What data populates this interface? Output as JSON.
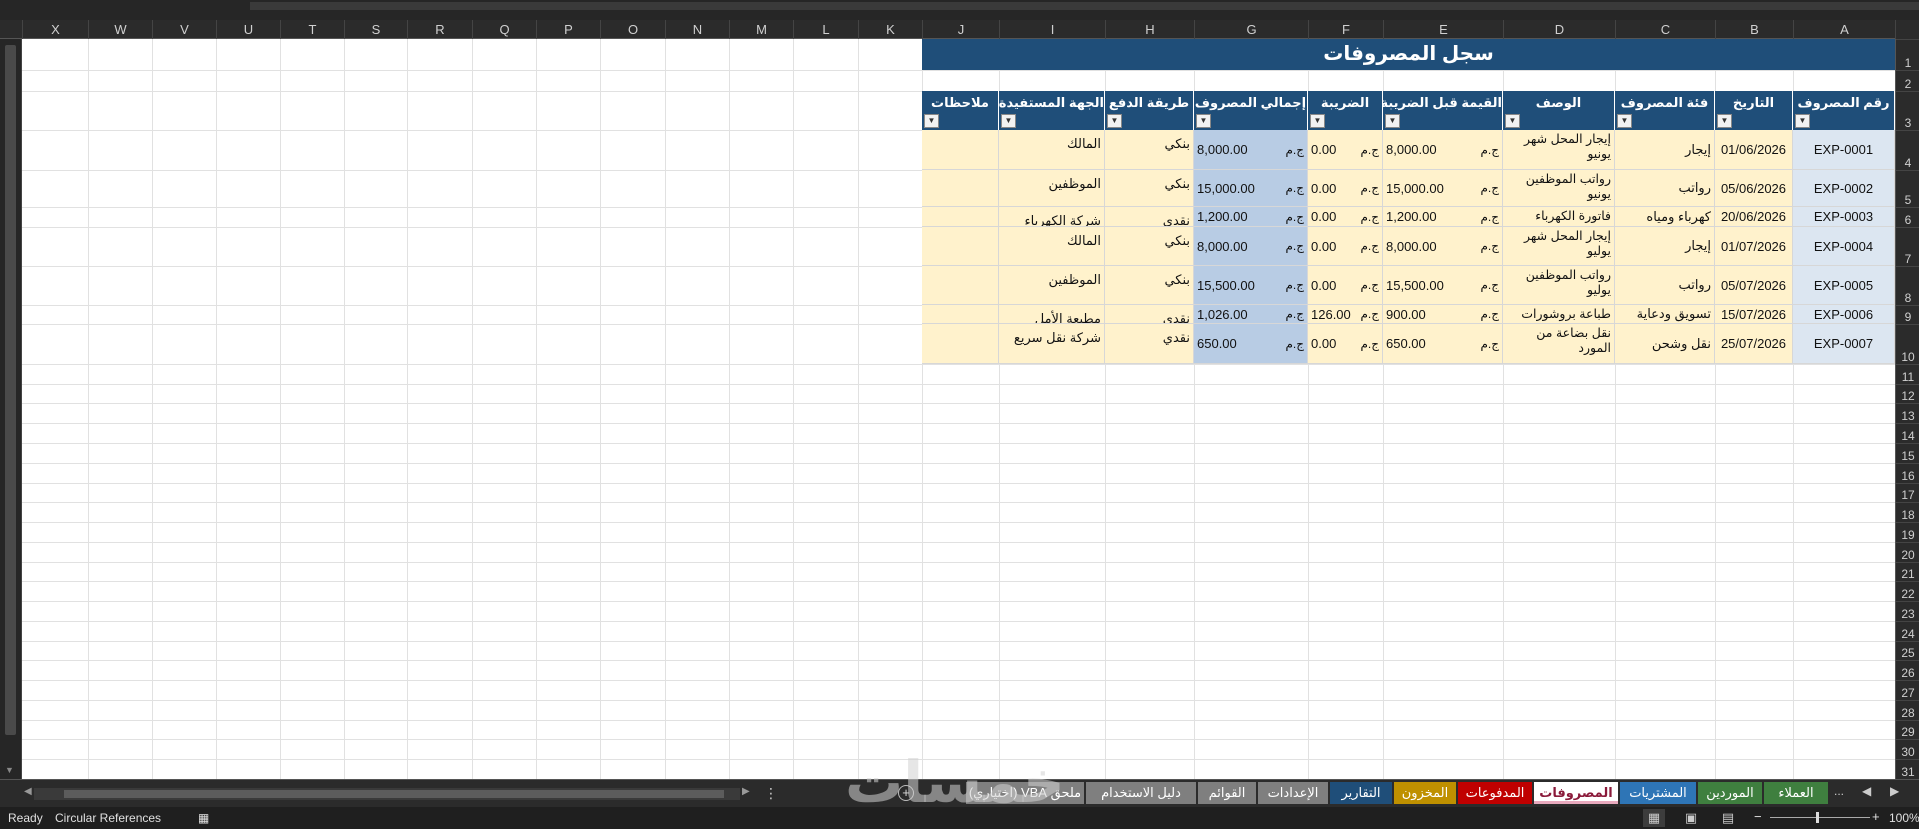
{
  "columns": [
    "X",
    "W",
    "V",
    "U",
    "T",
    "S",
    "R",
    "Q",
    "P",
    "O",
    "N",
    "M",
    "L",
    "K",
    "J",
    "I",
    "H",
    "G",
    "F",
    "E",
    "D",
    "C",
    "B",
    "A"
  ],
  "rows": [
    "1",
    "2",
    "3",
    "4",
    "5",
    "6",
    "7",
    "8",
    "9",
    "10",
    "11",
    "12",
    "13",
    "14",
    "15",
    "16",
    "17",
    "18",
    "19",
    "20",
    "21",
    "22",
    "23",
    "24",
    "25",
    "26",
    "27",
    "28",
    "29",
    "30",
    "31"
  ],
  "sheet": {
    "title": "سجل المصروفات",
    "headers": {
      "A": "رقم المصروف",
      "B": "التاريخ",
      "C": "فئة المصروف",
      "D": "الوصف",
      "E": "القيمة قبل الضريبة",
      "F": "الضريبة",
      "G": "إجمالي المصروف",
      "H": "طريقة الدفع",
      "I": "الجهة المستفيدة",
      "J": "ملاحظات"
    },
    "currency": "ج.م",
    "records": [
      {
        "id": "EXP-0001",
        "date": "01/06/2026",
        "category": "إيجار",
        "desc": "إيجار المحل شهر يونيو",
        "before_tax": "8,000.00",
        "tax": "0.00",
        "total": "8,000.00",
        "method": "بنكي",
        "payee": "المالك",
        "notes": ""
      },
      {
        "id": "EXP-0002",
        "date": "05/06/2026",
        "category": "رواتب",
        "desc": "رواتب الموظفين يونيو",
        "before_tax": "15,000.00",
        "tax": "0.00",
        "total": "15,000.00",
        "method": "بنكي",
        "payee": "الموظفين",
        "notes": ""
      },
      {
        "id": "EXP-0003",
        "date": "20/06/2026",
        "category": "كهرباء ومياه",
        "desc": "فاتورة الكهرباء",
        "before_tax": "1,200.00",
        "tax": "0.00",
        "total": "1,200.00",
        "method": "نقدي",
        "payee": "شركة الكهرباء",
        "notes": ""
      },
      {
        "id": "EXP-0004",
        "date": "01/07/2026",
        "category": "إيجار",
        "desc": "إيجار المحل شهر يوليو",
        "before_tax": "8,000.00",
        "tax": "0.00",
        "total": "8,000.00",
        "method": "بنكي",
        "payee": "المالك",
        "notes": ""
      },
      {
        "id": "EXP-0005",
        "date": "05/07/2026",
        "category": "رواتب",
        "desc": "رواتب الموظفين يوليو",
        "before_tax": "15,500.00",
        "tax": "0.00",
        "total": "15,500.00",
        "method": "بنكي",
        "payee": "الموظفين",
        "notes": ""
      },
      {
        "id": "EXP-0006",
        "date": "15/07/2026",
        "category": "تسويق ودعاية",
        "desc": "طباعة بروشورات",
        "before_tax": "900.00",
        "tax": "126.00",
        "total": "1,026.00",
        "method": "نقدي",
        "payee": "مطبعة الأمل",
        "notes": ""
      },
      {
        "id": "EXP-0007",
        "date": "25/07/2026",
        "category": "نقل وشحن",
        "desc": "نقل بضاعة من المورد",
        "before_tax": "650.00",
        "tax": "0.00",
        "total": "650.00",
        "method": "نقدي",
        "payee": "شركة نقل سريع",
        "notes": ""
      }
    ]
  },
  "tabs": [
    {
      "label": "العملاء",
      "color": "#3f7f3f",
      "active": false
    },
    {
      "label": "الموردين",
      "color": "#3f7f3f",
      "active": false
    },
    {
      "label": "المشتريات",
      "color": "#2e75b6",
      "active": false
    },
    {
      "label": "المصروفات",
      "color": "#f3d9e1",
      "active": true
    },
    {
      "label": "المدفوعات",
      "color": "#c00000",
      "active": false
    },
    {
      "label": "المخزون",
      "color": "#bf9000",
      "active": false
    },
    {
      "label": "التقارير",
      "color": "#1f4e79",
      "active": false
    },
    {
      "label": "الإعدادات",
      "color": "#7f7f7f",
      "active": false
    },
    {
      "label": "القوائم",
      "color": "#7f7f7f",
      "active": false
    },
    {
      "label": "دليل الاستخدام",
      "color": "#7f7f7f",
      "active": false
    },
    {
      "label": "ملحق VBA (اختياري)",
      "color": "#7f7f7f",
      "active": false
    }
  ],
  "tab_overflow": "...",
  "status": {
    "ready": "Ready",
    "circular": "Circular References",
    "zoom": "100%",
    "zoom_minus": "−",
    "zoom_plus": "+"
  },
  "watermark": "خمسات"
}
